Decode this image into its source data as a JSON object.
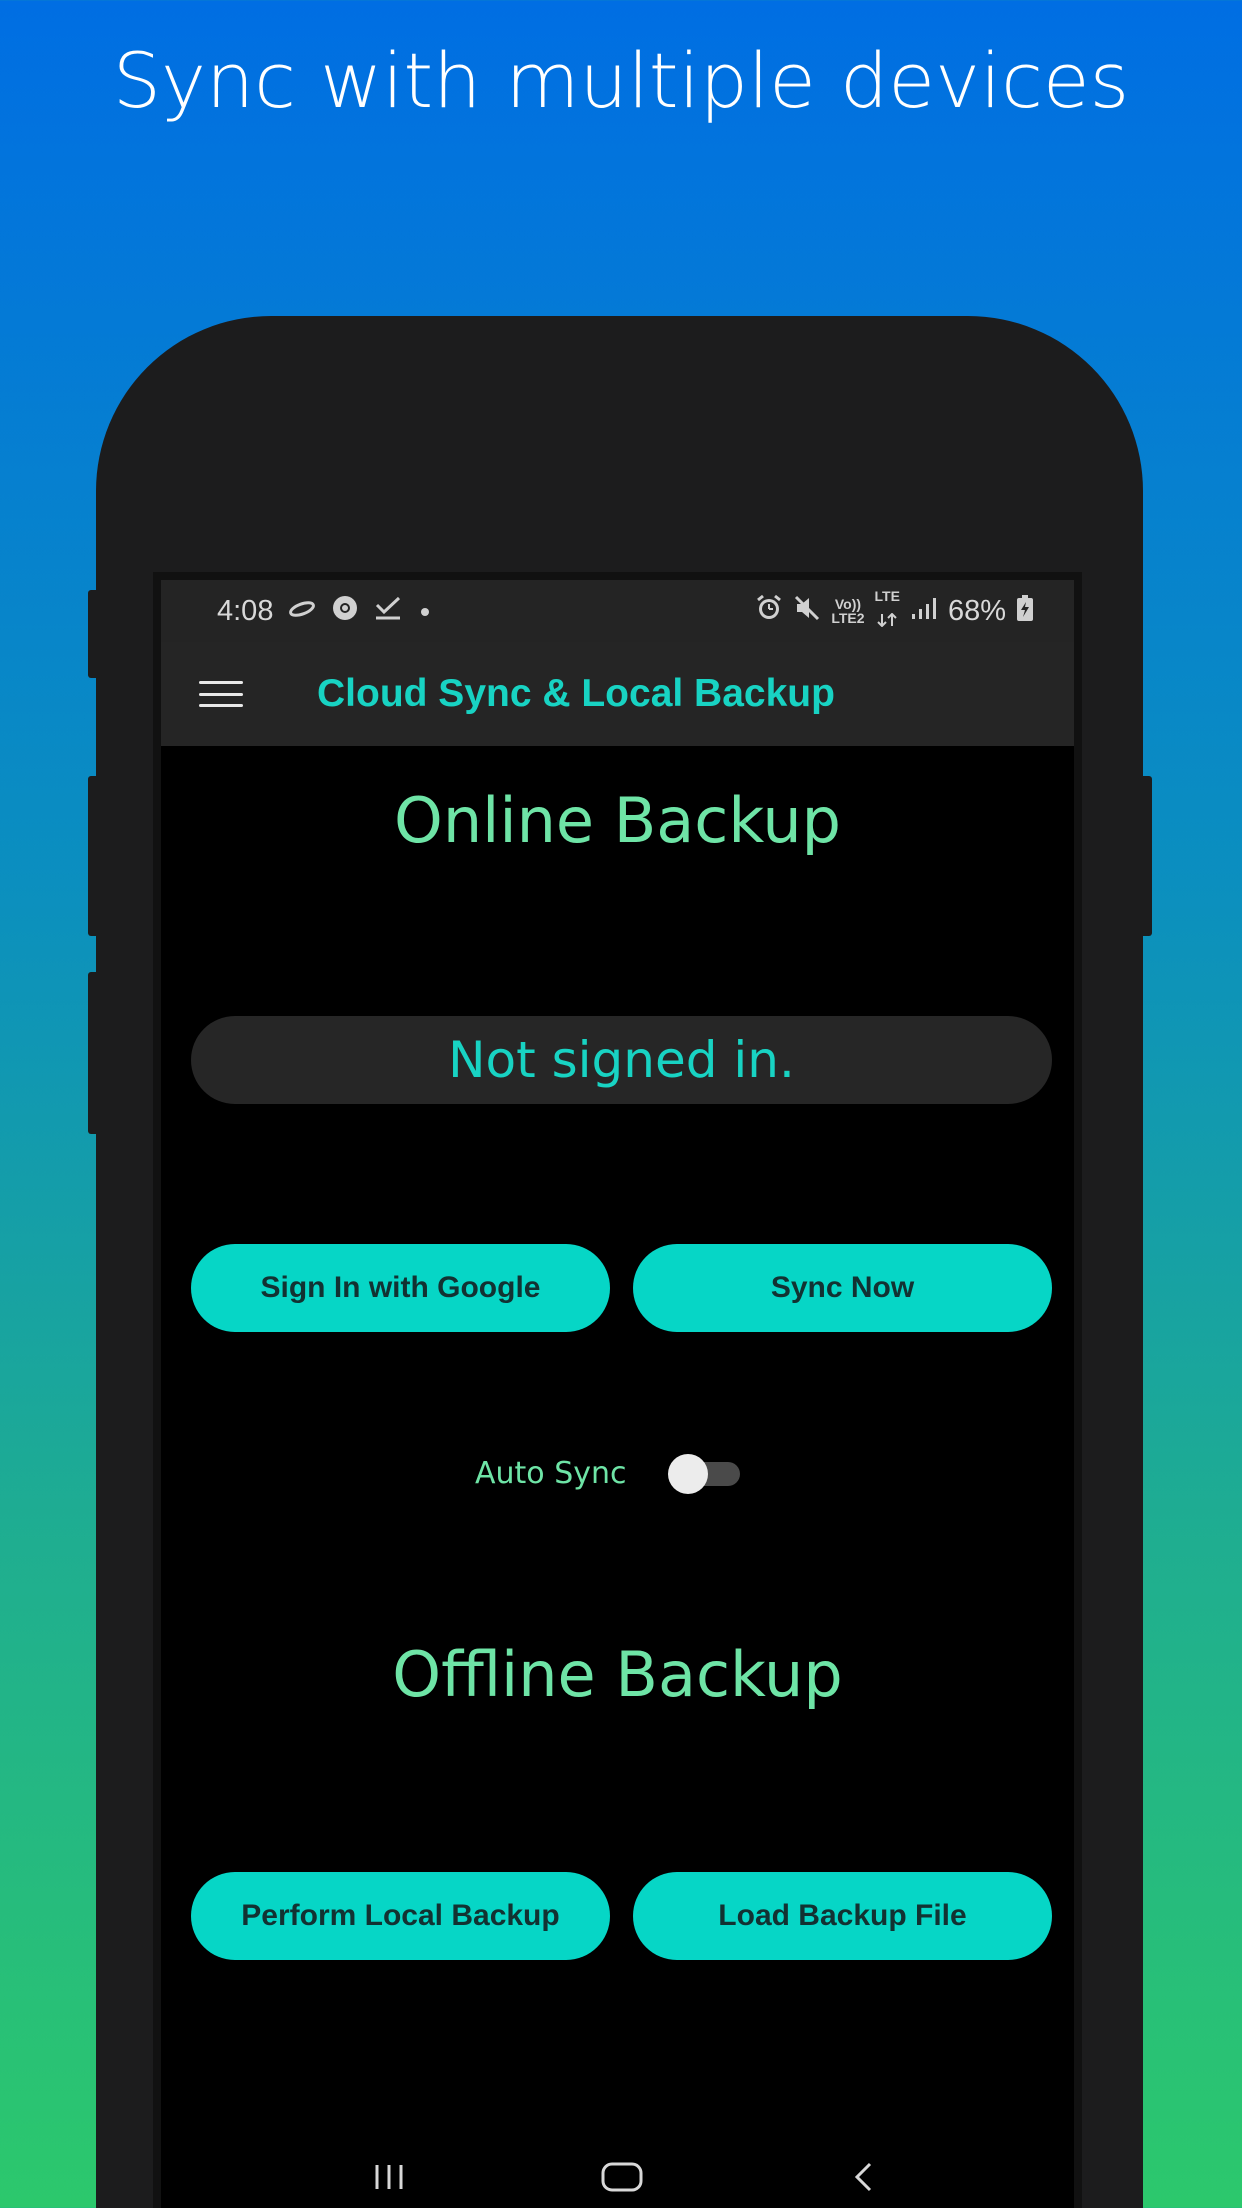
{
  "promo": {
    "title": "Sync with multiple devices"
  },
  "status_bar": {
    "time": "4:08",
    "left_icons": [
      "notification-icon",
      "chrome-icon",
      "download-done-icon",
      "dot-icon"
    ],
    "volte_top": "Vo))",
    "volte_bottom": "LTE2",
    "lte_label": "LTE",
    "battery": "68%",
    "right_icons": [
      "alarm-icon",
      "mute-icon",
      "volte-icon",
      "lte-data-icon",
      "signal-icon",
      "battery-charging-icon"
    ]
  },
  "app_bar": {
    "title": "Cloud Sync & Local Backup",
    "menu_icon": "hamburger-menu-icon"
  },
  "online": {
    "heading": "Online Backup",
    "status_text": "Not signed in.",
    "sign_in_label": "Sign In with Google",
    "sync_now_label": "Sync Now",
    "auto_sync_label": "Auto Sync",
    "auto_sync_on": false
  },
  "offline": {
    "heading": "Offline Backup",
    "local_backup_label": "Perform Local Backup",
    "load_backup_label": "Load Backup File"
  },
  "nav_bar": {
    "icons": [
      "recent-apps-icon",
      "home-icon",
      "back-icon"
    ]
  },
  "colors": {
    "accent": "#06d6c6",
    "heading_green": "#6ee4a6",
    "teal_text": "#18d3c3",
    "background_top": "#006ee3",
    "background_bottom": "#2cc86c"
  }
}
